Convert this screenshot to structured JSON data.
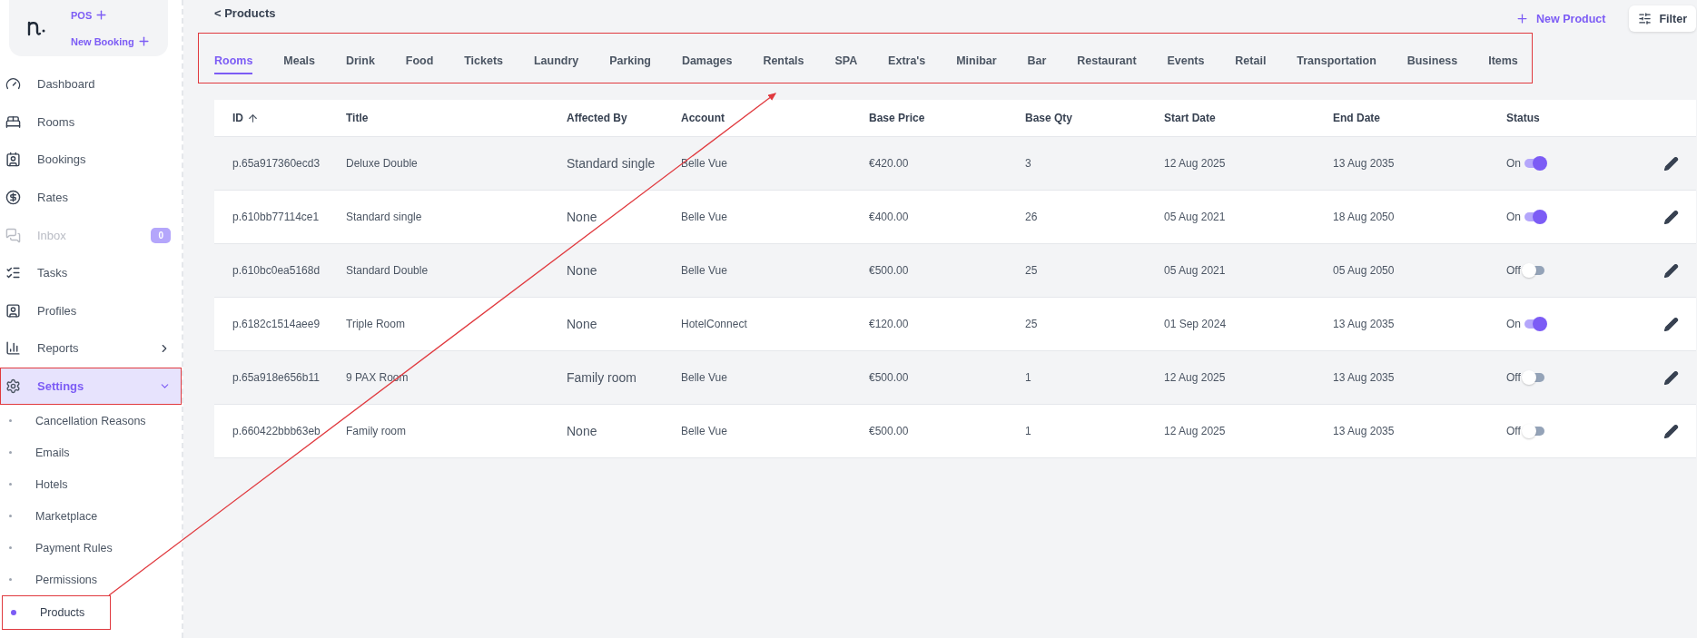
{
  "brand": {
    "quick_actions": [
      {
        "label": "POS"
      },
      {
        "label": "New Booking"
      }
    ]
  },
  "sidebar": {
    "items": [
      {
        "label": "Dashboard",
        "selected": false,
        "disabled": false
      },
      {
        "label": "Rooms",
        "selected": false,
        "disabled": false
      },
      {
        "label": "Bookings",
        "selected": false,
        "disabled": false
      },
      {
        "label": "Rates",
        "selected": false,
        "disabled": false
      },
      {
        "label": "Inbox",
        "selected": false,
        "disabled": true,
        "badge": "0"
      },
      {
        "label": "Tasks",
        "selected": false,
        "disabled": false
      },
      {
        "label": "Profiles",
        "selected": false,
        "disabled": false
      },
      {
        "label": "Reports",
        "selected": false,
        "disabled": false,
        "expanded": false
      },
      {
        "label": "Settings",
        "selected": true,
        "disabled": false,
        "expanded": true,
        "children": [
          {
            "label": "Cancellation Reasons",
            "selected": false
          },
          {
            "label": "Emails",
            "selected": false
          },
          {
            "label": "Hotels",
            "selected": false
          },
          {
            "label": "Marketplace",
            "selected": false
          },
          {
            "label": "Payment Rules",
            "selected": false
          },
          {
            "label": "Permissions",
            "selected": false
          },
          {
            "label": "Products",
            "selected": true
          }
        ]
      }
    ]
  },
  "header": {
    "back_link": "< Products",
    "new_button": "New Product",
    "filter_button": "Filter"
  },
  "tabs": [
    {
      "label": "Rooms",
      "selected": true
    },
    {
      "label": "Meals",
      "selected": false
    },
    {
      "label": "Drink",
      "selected": false
    },
    {
      "label": "Food",
      "selected": false
    },
    {
      "label": "Tickets",
      "selected": false
    },
    {
      "label": "Laundry",
      "selected": false
    },
    {
      "label": "Parking",
      "selected": false
    },
    {
      "label": "Damages",
      "selected": false
    },
    {
      "label": "Rentals",
      "selected": false
    },
    {
      "label": "SPA",
      "selected": false
    },
    {
      "label": "Extra's",
      "selected": false
    },
    {
      "label": "Minibar",
      "selected": false
    },
    {
      "label": "Bar",
      "selected": false
    },
    {
      "label": "Restaurant",
      "selected": false
    },
    {
      "label": "Events",
      "selected": false
    },
    {
      "label": "Retail",
      "selected": false
    },
    {
      "label": "Transportation",
      "selected": false
    },
    {
      "label": "Business",
      "selected": false
    },
    {
      "label": "Items",
      "selected": false
    }
  ],
  "table": {
    "columns": [
      {
        "label": "ID",
        "sorted": true
      },
      {
        "label": "Title",
        "sorted": false
      },
      {
        "label": "Affected By",
        "sorted": false
      },
      {
        "label": "Account",
        "sorted": false
      },
      {
        "label": "Base Price",
        "sorted": false
      },
      {
        "label": "Base Qty",
        "sorted": false
      },
      {
        "label": "Start Date",
        "sorted": false
      },
      {
        "label": "End Date",
        "sorted": false
      },
      {
        "label": "Status",
        "sorted": false
      }
    ],
    "rows": [
      {
        "id": "p.65a917360ecd3",
        "title": "Deluxe Double",
        "affected_by": "Standard single",
        "account": "Belle Vue",
        "base_price": "€420.00",
        "base_qty": "3",
        "start_date": "12 Aug 2025",
        "end_date": "13 Aug 2035",
        "status": "On",
        "on": true
      },
      {
        "id": "p.610bb77114ce1",
        "title": "Standard single",
        "affected_by": "None",
        "account": "Belle Vue",
        "base_price": "€400.00",
        "base_qty": "26",
        "start_date": "05 Aug 2021",
        "end_date": "18 Aug 2050",
        "status": "On",
        "on": true
      },
      {
        "id": "p.610bc0ea5168d",
        "title": "Standard Double",
        "affected_by": "None",
        "account": "Belle Vue",
        "base_price": "€500.00",
        "base_qty": "25",
        "start_date": "05 Aug 2021",
        "end_date": "05 Aug 2050",
        "status": "Off",
        "on": false
      },
      {
        "id": "p.6182c1514aee9",
        "title": "Triple Room",
        "affected_by": "None",
        "account": "HotelConnect",
        "base_price": "€120.00",
        "base_qty": "25",
        "start_date": "01 Sep 2024",
        "end_date": "13 Aug 2035",
        "status": "On",
        "on": true
      },
      {
        "id": "p.65a918e656b11",
        "title": "9 PAX Room",
        "affected_by": "Family room",
        "account": "Belle Vue",
        "base_price": "€500.00",
        "base_qty": "1",
        "start_date": "12 Aug 2025",
        "end_date": "13 Aug 2035",
        "status": "Off",
        "on": false
      },
      {
        "id": "p.660422bbb63eb",
        "title": "Family room",
        "affected_by": "None",
        "account": "Belle Vue",
        "base_price": "€500.00",
        "base_qty": "1",
        "start_date": "12 Aug 2025",
        "end_date": "13 Aug 2035",
        "status": "Off",
        "on": false
      }
    ]
  }
}
